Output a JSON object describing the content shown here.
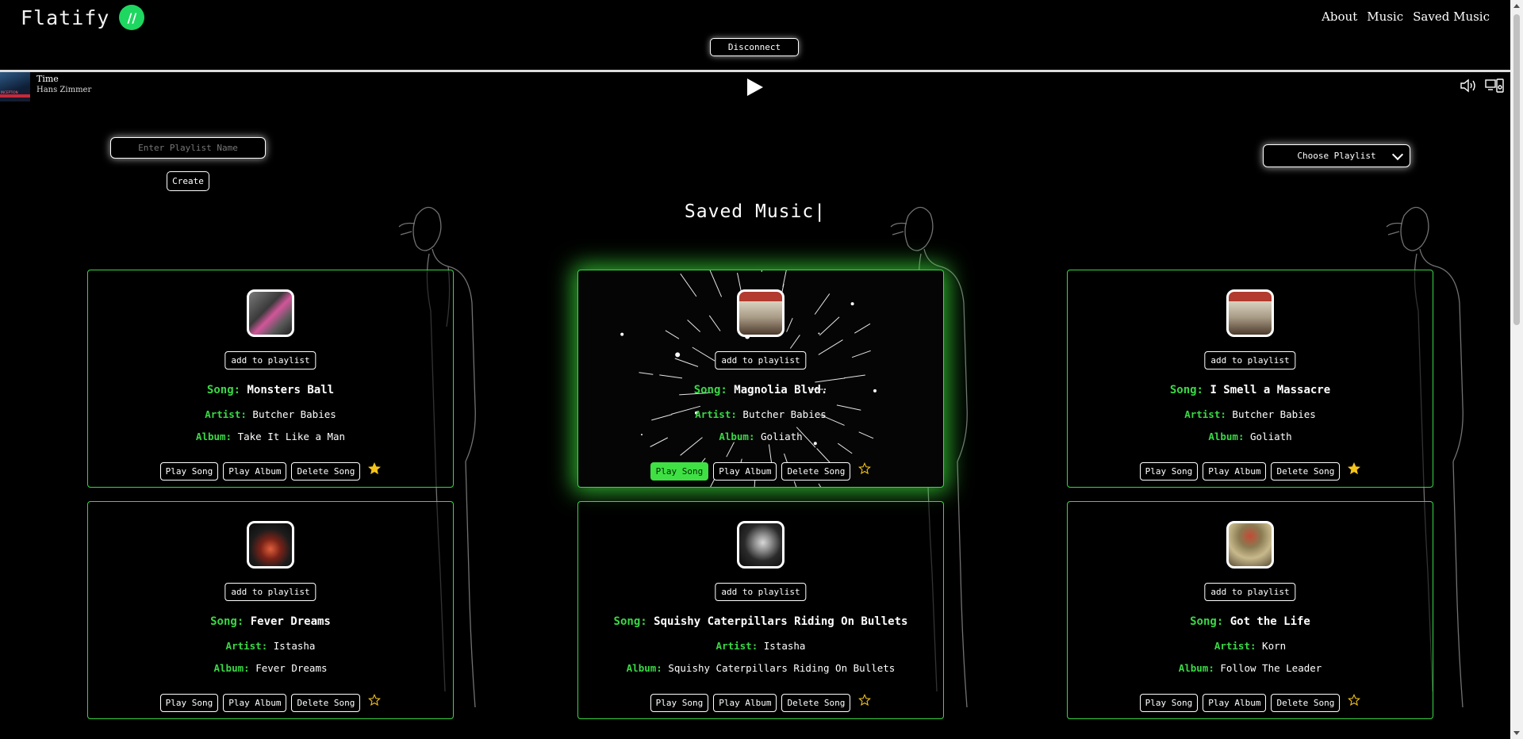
{
  "brand": {
    "name": "Flatify",
    "logo_text": "//"
  },
  "nav": {
    "about": "About",
    "music": "Music",
    "saved_music": "Saved Music"
  },
  "disconnect_label": "Disconnect",
  "player": {
    "title": "Time",
    "artist": "Hans Zimmer",
    "cover_text": "INCEPTION"
  },
  "playlist": {
    "input_placeholder": "Enter Playlist Name",
    "create_label": "Create",
    "choose_label": "Choose Playlist"
  },
  "section_title": "Saved Music|",
  "labels": {
    "song": "Song:",
    "artist": "Artist:",
    "album": "Album:",
    "add_to_playlist": "add to playlist",
    "play_song": "Play Song",
    "play_album": "Play Album",
    "delete_song": "Delete Song"
  },
  "colors": {
    "accent": "#39d845",
    "star": "#f5c518",
    "background": "#000000"
  },
  "songs": [
    {
      "song": "Monsters Ball",
      "artist": "Butcher Babies",
      "album": "Take It Like a Man",
      "favorite": true,
      "active": false,
      "cover": "pink"
    },
    {
      "song": "Magnolia Blvd.",
      "artist": "Butcher Babies",
      "album": "Goliath",
      "favorite": false,
      "active": true,
      "cover": "goliath"
    },
    {
      "song": "I Smell a Massacre",
      "artist": "Butcher Babies",
      "album": "Goliath",
      "favorite": true,
      "active": false,
      "cover": "goliath"
    },
    {
      "song": "Fever Dreams",
      "artist": "Istasha",
      "album": "Fever Dreams",
      "favorite": false,
      "active": false,
      "cover": "fever"
    },
    {
      "song": "Squishy Caterpillars Riding On Bullets",
      "artist": "Istasha",
      "album": "Squishy Caterpillars Riding On Bullets",
      "favorite": false,
      "active": false,
      "cover": "squishy"
    },
    {
      "song": "Got the Life",
      "artist": "Korn",
      "album": "Follow The Leader",
      "favorite": false,
      "active": false,
      "cover": "korn"
    }
  ]
}
